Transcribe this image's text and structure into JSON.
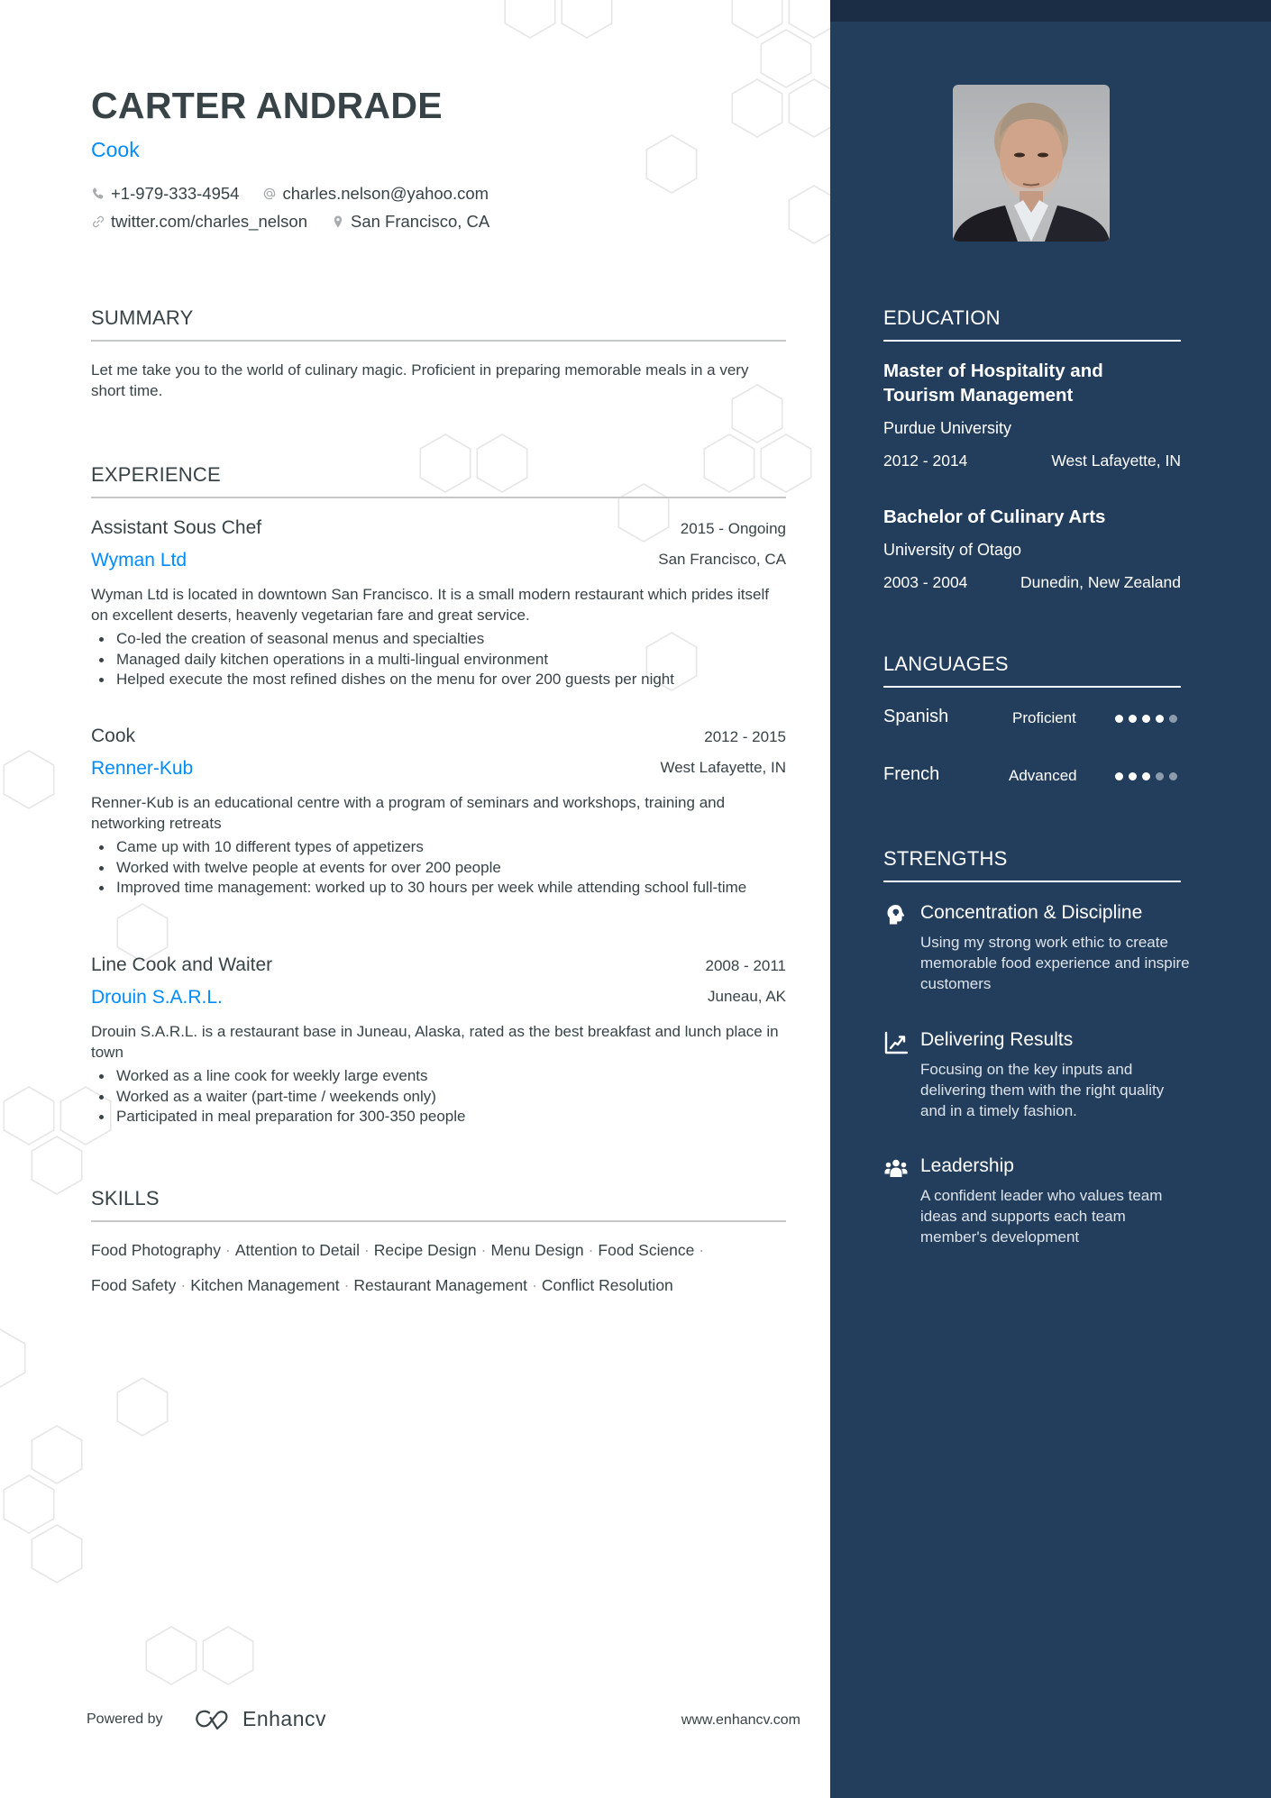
{
  "header": {
    "name": "CARTER ANDRADE",
    "title": "Cook",
    "contacts": [
      {
        "icon": "phone-icon",
        "text": "+1-979-333-4954"
      },
      {
        "icon": "at-icon",
        "text": "charles.nelson@yahoo.com"
      },
      {
        "icon": "link-icon",
        "text": "twitter.com/charles_nelson"
      },
      {
        "icon": "location-pin-icon",
        "text": "San Francisco, CA"
      }
    ]
  },
  "summary": {
    "heading": "SUMMARY",
    "text": "Let me take you to the world of culinary magic. Proficient in preparing memorable meals in a very short time."
  },
  "experience": {
    "heading": "EXPERIENCE",
    "items": [
      {
        "role": "Assistant Sous Chef",
        "dates": "2015 - Ongoing",
        "company": "Wyman Ltd",
        "location": "San Francisco, CA",
        "description": "Wyman Ltd is located in downtown San Francisco. It is a small modern restaurant which prides itself on excellent deserts, heavenly vegetarian fare and great service.",
        "bullets": [
          "Co-led the creation of seasonal menus and specialties",
          "Managed daily kitchen operations in a multi-lingual environment",
          "Helped execute the most refined dishes on the menu for over 200 guests per night"
        ]
      },
      {
        "role": "Cook",
        "dates": "2012 - 2015",
        "company": "Renner-Kub",
        "location": "West Lafayette, IN",
        "description": "Renner-Kub is an educational centre with a program of seminars and workshops, training and networking retreats",
        "bullets": [
          "Came up with 10 different types of appetizers",
          "Worked with twelve people at events for over 200 people",
          "Improved time management: worked up to 30 hours per week while attending school full-time"
        ]
      },
      {
        "role": "Line Cook and Waiter",
        "dates": "2008 - 2011",
        "company": "Drouin S.A.R.L.",
        "location": "Juneau, AK",
        "description": "Drouin S.A.R.L. is a restaurant base in Juneau, Alaska, rated as the best breakfast and lunch place in town",
        "bullets": [
          "Worked as a line cook for weekly large events",
          "Worked as a waiter (part-time / weekends only)",
          "Participated in meal preparation for 300-350 people"
        ]
      }
    ]
  },
  "skills": {
    "heading": "SKILLS",
    "items": [
      "Food Photography",
      "Attention to Detail",
      "Recipe Design",
      "Menu Design",
      "Food Science",
      "Food Safety",
      "Kitchen Management",
      "Restaurant Management",
      "Conflict Resolution"
    ]
  },
  "footer": {
    "powered_by": "Powered by",
    "brand": "Enhancv",
    "url": "www.enhancv.com"
  },
  "sidebar": {
    "photo_alt": "Profile photo of Carter Andrade",
    "education": {
      "heading": "EDUCATION",
      "items": [
        {
          "degree": "Master of Hospitality and Tourism Management",
          "school": "Purdue University",
          "dates": "2012 - 2014",
          "location": "West Lafayette, IN"
        },
        {
          "degree": "Bachelor of Culinary Arts",
          "school": "University of Otago",
          "dates": "2003 - 2004",
          "location": "Dunedin, New Zealand"
        }
      ]
    },
    "languages": {
      "heading": "LANGUAGES",
      "items": [
        {
          "name": "Spanish",
          "level": "Proficient",
          "rating": 4,
          "max": 5
        },
        {
          "name": "French",
          "level": "Advanced",
          "rating": 3,
          "max": 5
        }
      ]
    },
    "strengths": {
      "heading": "STRENGTHS",
      "items": [
        {
          "icon": "brain-head-icon",
          "title": "Concentration & Discipline",
          "description": "Using my strong work ethic to create memorable food experience and inspire customers"
        },
        {
          "icon": "chart-line-icon",
          "title": "Delivering Results",
          "description": "Focusing on the key inputs and delivering them with the right quality and in a timely fashion."
        },
        {
          "icon": "users-icon",
          "title": "Leadership",
          "description": "A confident leader who values team ideas and supports each team member's development"
        }
      ]
    }
  },
  "colors": {
    "accent": "#008cff",
    "sidebar_bg": "#233e5c",
    "sidebar_top": "#1b2d44",
    "text": "#384347",
    "rule": "#c5c7c8",
    "hex_stroke": "#e6e6e6"
  }
}
